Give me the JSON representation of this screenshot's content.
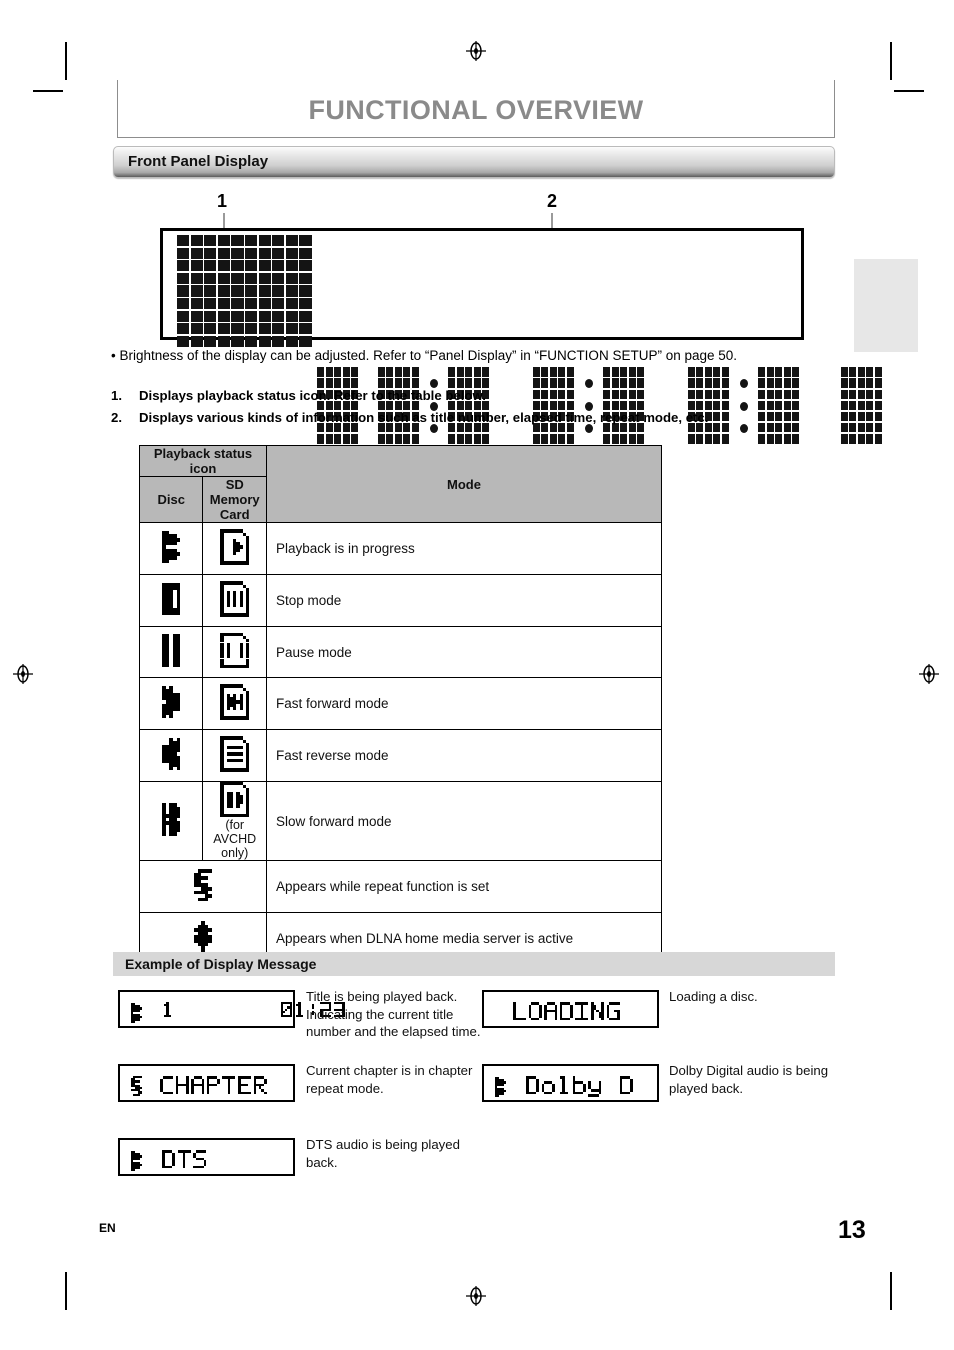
{
  "document": {
    "chapter_title": "FUNCTIONAL OVERVIEW",
    "section_title": "Front Panel Display",
    "language_code": "EN",
    "page_number": "13"
  },
  "diagram": {
    "callouts": [
      {
        "number": "1",
        "region": "playback-status-icon-area"
      },
      {
        "number": "2",
        "region": "information-text-area"
      }
    ]
  },
  "notes": {
    "bullet": "• Brightness of the display can be adjusted. Refer to “Panel Display” in “FUNCTION SETUP” on page 50."
  },
  "numbered_list": [
    {
      "number": "1.",
      "text": "Displays playback status icon. Refer to the table below."
    },
    {
      "number": "2.",
      "text": "Displays various kinds of information such as title number, elapsed time, repeat mode, etc."
    }
  ],
  "status_table": {
    "group_header": "Playback status icon",
    "headers": {
      "disc": "Disc",
      "sd": "SD Memory Card",
      "mode": "Mode"
    },
    "rows": [
      {
        "disc_icon": "play-icon",
        "sd_icon": "sd-play-icon",
        "mode": "Playback is in progress",
        "note": ""
      },
      {
        "disc_icon": "stop-icon",
        "sd_icon": "sd-stop-icon",
        "mode": "Stop mode",
        "note": ""
      },
      {
        "disc_icon": "pause-icon",
        "sd_icon": "sd-pause-icon",
        "mode": "Pause mode",
        "note": ""
      },
      {
        "disc_icon": "fast-forward-icon",
        "sd_icon": "sd-fast-forward-icon",
        "mode": "Fast forward mode",
        "note": ""
      },
      {
        "disc_icon": "fast-reverse-icon",
        "sd_icon": "sd-fast-reverse-icon",
        "mode": "Fast reverse mode",
        "note": ""
      },
      {
        "disc_icon": "slow-forward-icon",
        "sd_icon": "sd-slow-forward-icon",
        "mode": "Slow forward mode",
        "note": "(for AVCHD only)"
      }
    ],
    "span_rows": [
      {
        "icon": "repeat-icon",
        "mode": "Appears while repeat function is set"
      },
      {
        "icon": "dlna-icon",
        "mode": "Appears when DLNA home media server is active"
      }
    ]
  },
  "examples": {
    "heading": "Example of Display Message",
    "items": [
      {
        "lcd_icon": "play-icon",
        "lcd_text": "1        01:23",
        "description": "Title is being played back. Indicating the current title number and the elapsed time."
      },
      {
        "lcd_icon": "none",
        "lcd_text": "LOADING",
        "description": "Loading a disc."
      },
      {
        "lcd_icon": "repeat-icon",
        "lcd_text": "CHAPTER",
        "description": "Current chapter is in chapter repeat mode."
      },
      {
        "lcd_icon": "play-icon",
        "lcd_text": "Dolby D",
        "description": "Dolby Digital audio is being played back."
      },
      {
        "lcd_icon": "play-icon",
        "lcd_text": "DTS",
        "description": "DTS audio is being played back."
      }
    ]
  },
  "colors": {
    "title_gray": "#8a8a8a",
    "table_header_gray": "#b8b8b8",
    "example_bar_gray": "#d7d7d7",
    "side_tab_gray": "#e7e7e7",
    "dot_black": "#111111"
  }
}
